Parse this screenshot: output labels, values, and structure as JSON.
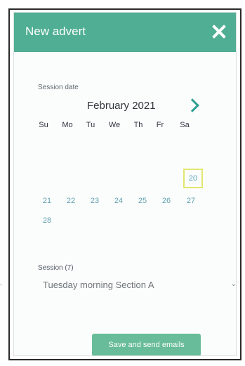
{
  "window": {
    "title": "New advert",
    "close_icon": "close-icon"
  },
  "calendar": {
    "label": "Session date",
    "month": "February 2021",
    "next_icon": "chevron-right-icon",
    "weekdays": [
      "Su",
      "Mo",
      "Tu",
      "We",
      "Th",
      "Fr",
      "Sa"
    ],
    "days": {
      "d20": "20",
      "d21": "21",
      "d22": "22",
      "d23": "23",
      "d24": "24",
      "d25": "25",
      "d26": "26",
      "d27": "27",
      "d28": "28"
    },
    "selected_day": "20"
  },
  "session": {
    "label": "Session (7)",
    "value": "Tuesday morning Section A",
    "dropdown_icon": "chevron-down-icon"
  },
  "actions": {
    "save_label": "Save and send emails"
  },
  "colors": {
    "header": "#4fae93",
    "accent": "#2f9f92",
    "button": "#68bc99",
    "selected_border": "#e2e66f"
  }
}
